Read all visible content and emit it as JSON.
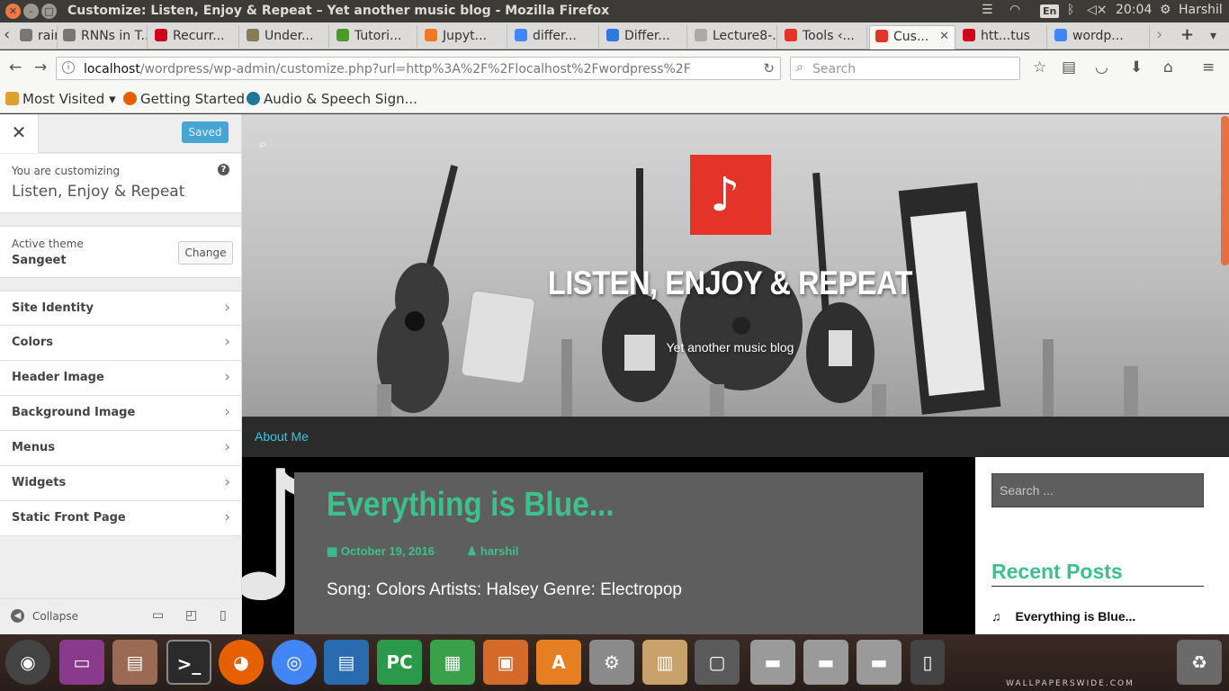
{
  "os": {
    "window_title": "Customize: Listen, Enjoy & Repeat – Yet another music blog - Mozilla Firefox",
    "keyboard_layout": "En",
    "clock": "20:04",
    "user": "Harshil"
  },
  "tabs": [
    {
      "label": "rain",
      "color": "#777777"
    },
    {
      "label": "RNNs in T...",
      "color": "#777777"
    },
    {
      "label": "Recurr...",
      "color": "#d0021b"
    },
    {
      "label": "Under...",
      "color": "#8a7a55"
    },
    {
      "label": "Tutori...",
      "color": "#4a9a2a"
    },
    {
      "label": "Jupyt...",
      "color": "#f37726"
    },
    {
      "label": "differ...",
      "color": "#4285f4"
    },
    {
      "label": "Differ...",
      "color": "#2a7ae2"
    },
    {
      "label": "Lecture8-...",
      "color": "#aaaaaa"
    },
    {
      "label": "Tools ‹...",
      "color": "#e4342a"
    },
    {
      "label": "Cus...",
      "color": "#e4342a",
      "active": true
    },
    {
      "label": "htt...tus",
      "color": "#d0021b"
    },
    {
      "label": "wordp...",
      "color": "#4285f4"
    }
  ],
  "nav": {
    "url_host": "localhost",
    "url_path": "/wordpress/wp-admin/customize.php?url=http%3A%2F%2Flocalhost%2Fwordpress%2F",
    "search_placeholder": "Search"
  },
  "bookmarks": [
    {
      "label": "Most Visited ▾",
      "color": "#e0a030"
    },
    {
      "label": "Getting Started",
      "color": "#e66000"
    },
    {
      "label": "Audio & Speech Sign...",
      "color": "#21759b"
    }
  ],
  "customizer": {
    "saved_label": "Saved",
    "customizing_label": "You are customizing",
    "site_name": "Listen, Enjoy & Repeat",
    "active_theme_label": "Active theme",
    "theme_name": "Sangeet",
    "change_label": "Change",
    "sections": [
      "Site Identity",
      "Colors",
      "Header Image",
      "Background Image",
      "Menus",
      "Widgets",
      "Static Front Page"
    ],
    "collapse_label": "Collapse"
  },
  "site": {
    "title": "LISTEN, ENJOY & REPEAT",
    "tagline": "Yet another music blog",
    "menu_item": "About Me",
    "post": {
      "title": "Everything is Blue...",
      "date": "October 19, 2016",
      "author": "harshil",
      "excerpt": "Song: Colors Artists: Halsey Genre: Electropop"
    },
    "widget": {
      "search_placeholder": "Search ...",
      "recent_title": "Recent Posts",
      "recent_item": "Everything is Blue..."
    }
  },
  "launcher": {
    "watermark": "WALLPAPERSWIDE.COM"
  }
}
